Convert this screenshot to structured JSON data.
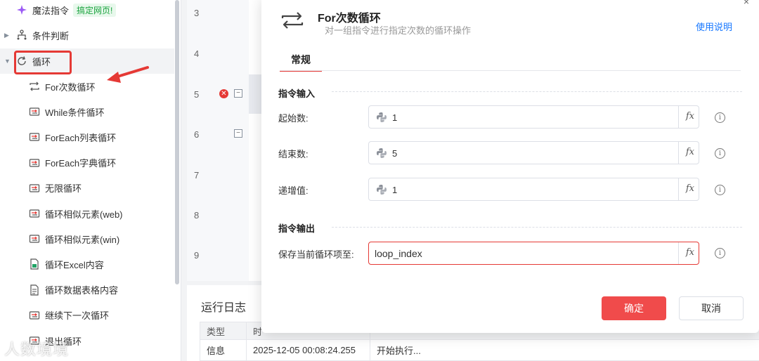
{
  "sidebar": {
    "magic": {
      "label": "魔法指令",
      "badge": "搞定网页!"
    },
    "condition": {
      "label": "条件判断"
    },
    "loop": {
      "label": "循环"
    },
    "items": [
      {
        "label": "For次数循环",
        "icon": "repeat-icon"
      },
      {
        "label": "While条件循环",
        "icon": "loop-icon"
      },
      {
        "label": "ForEach列表循环",
        "icon": "loop-icon"
      },
      {
        "label": "ForEach字典循环",
        "icon": "loop-icon"
      },
      {
        "label": "无限循环",
        "icon": "loop-icon"
      },
      {
        "label": "循环相似元素(web)",
        "icon": "loop-icon"
      },
      {
        "label": "循环相似元素(win)",
        "icon": "loop-icon"
      },
      {
        "label": "循环Excel内容",
        "icon": "excel-icon"
      },
      {
        "label": "循环数据表格内容",
        "icon": "table-icon"
      },
      {
        "label": "继续下一次循环",
        "icon": "loop-icon"
      },
      {
        "label": "退出循环",
        "icon": "loop-icon"
      }
    ]
  },
  "editor": {
    "line_numbers": [
      "3",
      "4",
      "5",
      "6",
      "7",
      "8",
      "9"
    ]
  },
  "log": {
    "title": "运行日志",
    "columns": [
      "类型",
      "时"
    ],
    "rows": [
      {
        "type": "信息",
        "time": "2025-12-05 00:08:24.255",
        "message": "开始执行..."
      }
    ]
  },
  "dialog": {
    "close": "×",
    "title": "For次数循环",
    "subtitle": "对一组指令进行指定次数的循环操作",
    "help": "使用说明",
    "tab": "常规",
    "section_input": "指令输入",
    "section_output": "指令输出",
    "fields": [
      {
        "label": "起始数:",
        "value": "1"
      },
      {
        "label": "结束数:",
        "value": "5"
      },
      {
        "label": "递增值:",
        "value": "1"
      }
    ],
    "output_field": {
      "label": "保存当前循环项至:",
      "value": "loop_index"
    },
    "fx": "fx",
    "info": "i",
    "ok": "确定",
    "cancel": "取消"
  },
  "watermark": "人数境境",
  "colors": {
    "accent": "#f04b4b",
    "link": "#1677ff",
    "badge_bg": "#e8f8ec",
    "badge_fg": "#1aa33e"
  }
}
